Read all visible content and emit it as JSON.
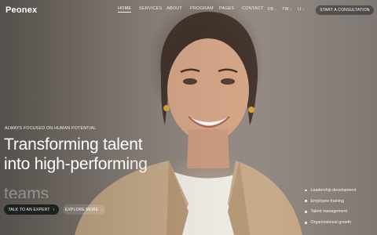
{
  "brand": {
    "logo_text": "Peonex"
  },
  "nav": {
    "items": [
      {
        "label": "HOME",
        "active": true
      },
      {
        "label": "SERVICES",
        "active": false
      },
      {
        "label": "ABOUT",
        "active": false
      },
      {
        "label": "PROGRAM",
        "active": false
      },
      {
        "label": "PAGES",
        "active": false
      },
      {
        "label": "CONTACT",
        "active": false
      }
    ]
  },
  "social": [
    {
      "label": "FB"
    },
    {
      "label": "TW"
    },
    {
      "label": "LI"
    }
  ],
  "header_cta": {
    "label": "START A CONSULTATION"
  },
  "hero": {
    "eyebrow": "ALWAYS FOCUSED ON HUMAN POTENTIAL",
    "headline_line1": "Transforming talent",
    "headline_line2_main": "into high-performi",
    "headline_line2_tail": "ng",
    "headline_line3": "teams"
  },
  "buttons": {
    "primary": "TALK TO AN EXPERT",
    "secondary": "EXPLORE MORE"
  },
  "services": [
    "Leadership development",
    "Employee training",
    "Talent management",
    "Organizational growth"
  ],
  "colors": {
    "primary_button_bg": "#1c2220",
    "text": "#ffffff",
    "background": "#8a8079"
  }
}
